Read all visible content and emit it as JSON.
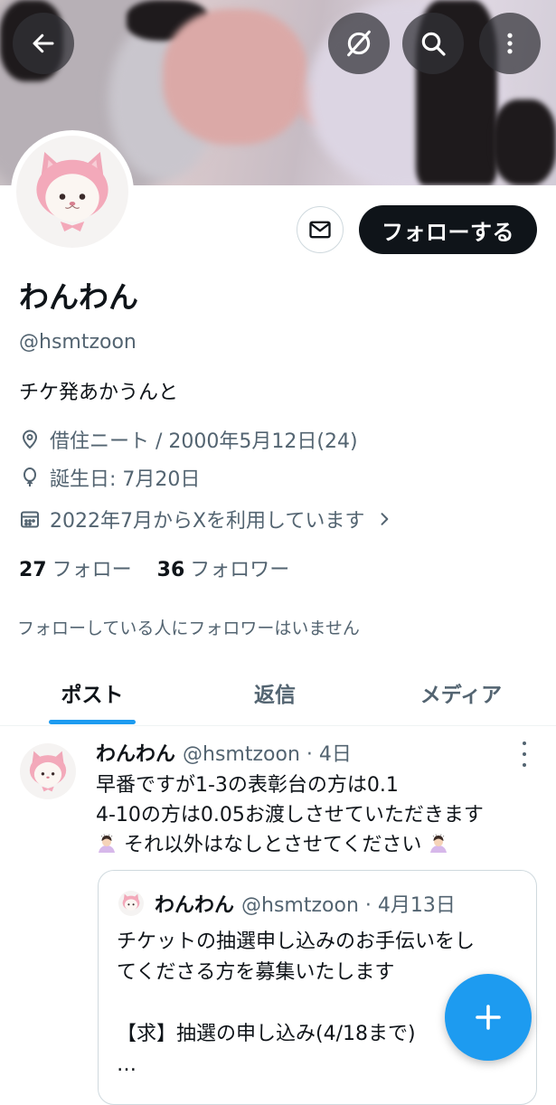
{
  "header": {
    "back_icon": "arrow-left-icon",
    "grok_icon": "grok-icon",
    "search_icon": "search-icon",
    "more_icon": "more-vertical-icon"
  },
  "profile": {
    "name": "わんわん",
    "handle": "@hsmtzoon",
    "bio": "チケ発あかうんと",
    "location": "借住ニート / 2000年5月12日(24)",
    "birthday": "誕生日: 7月20日",
    "joined": "2022年7月からXを利用しています",
    "following_count": "27",
    "following_label": "フォロー",
    "followers_count": "36",
    "followers_label": "フォロワー",
    "followers_you_know": "フォローしている人にフォロワーはいません",
    "follow_button": "フォローする",
    "message_icon": "mail-icon"
  },
  "tabs": [
    {
      "label": "ポスト",
      "active": true
    },
    {
      "label": "返信",
      "active": false
    },
    {
      "label": "メディア",
      "active": false
    }
  ],
  "post": {
    "name": "わんわん",
    "meta": "@hsmtzoon · 4日",
    "lines": [
      "早番ですが1-3の表彰台の方は0.1",
      "4-10の方は0.05お渡しさせていただきます",
      "それ以外はなしとさせてください"
    ],
    "quote": {
      "name": "わんわん",
      "meta": "@hsmtzoon · 4月13日",
      "lines": [
        "チケットの抽選申し込みのお手伝いをし",
        "てくださる方を募集いたします",
        "",
        "【求】抽選の申し込み(4/18まで)",
        "…"
      ]
    }
  },
  "fab_icon": "plus-icon",
  "colors": {
    "accent": "#1d9bf0",
    "text": "#0f1419",
    "secondary": "#536471"
  }
}
